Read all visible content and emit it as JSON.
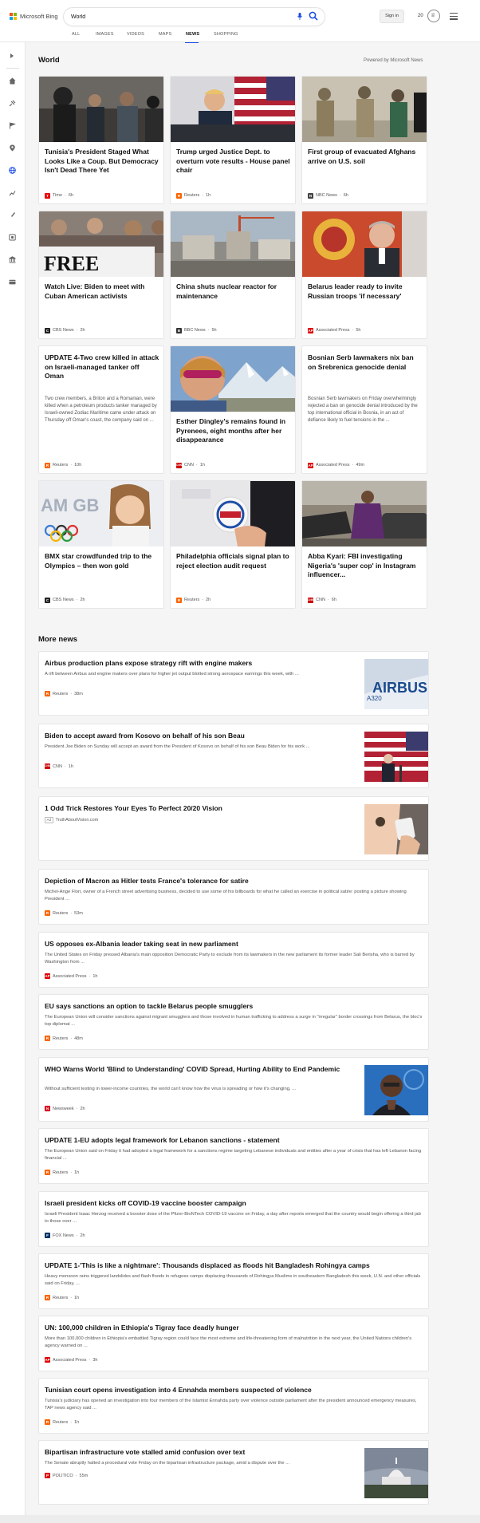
{
  "header": {
    "brand": "Microsoft Bing",
    "query": "World",
    "signin_label": "Sign in",
    "points": "20",
    "brand_colors": [
      "#f25022",
      "#7fba00",
      "#00a4ef",
      "#ffb900"
    ],
    "accent": "#174ae4"
  },
  "tabs": [
    "ALL",
    "IMAGES",
    "VIDEOS",
    "MAPS",
    "NEWS",
    "SHOPPING"
  ],
  "active_tab": "NEWS",
  "sidebar_icons": [
    "expand-icon",
    "home-icon",
    "sports-icon",
    "flag-icon",
    "location-pin-icon",
    "globe-icon",
    "business-icon",
    "science-icon",
    "entertainment-icon",
    "politics-icon",
    "money-icon"
  ],
  "main": {
    "title": "World",
    "powered": "Powered by Microsoft News",
    "more_news_title": "More news"
  },
  "cards": [
    {
      "title": "Tunisia's President Staged What Looks Like a Coup. But Democracy Isn't Dead There Yet",
      "source": "Time",
      "age": "6h",
      "logo": "T",
      "logo_color": "#e90606"
    },
    {
      "title": "Trump urged Justice Dept. to overturn vote results - House panel chair",
      "source": "Reuters",
      "age": "1h",
      "logo": "R",
      "logo_color": "#fa6400"
    },
    {
      "title": "First group of evacuated Afghans arrive on U.S. soil",
      "source": "NBC News",
      "age": "6h",
      "logo": "N",
      "logo_color": "#444444"
    },
    {
      "title": "Watch Live: Biden to meet with Cuban American activists",
      "source": "CBS News",
      "age": "2h",
      "logo": "C",
      "logo_color": "#222222"
    },
    {
      "title": "China shuts nuclear reactor for maintenance",
      "source": "BBC News",
      "age": "5h",
      "logo": "B",
      "logo_color": "#333333"
    },
    {
      "title": "Belarus leader ready to invite Russian troops 'if necessary'",
      "source": "Associated Press",
      "age": "5h",
      "logo": "AP",
      "logo_color": "#e00000"
    },
    {
      "title": "UPDATE 4-Two crew killed in attack on Israeli-managed tanker off Oman",
      "snippet": "Two crew members, a Briton and a Romanian, were killed when a petroleum products tanker managed by Israeli-owned Zodiac Maritime came under attack on Thursday off Oman's coast, the company said on ...",
      "source": "Reuters",
      "age": "10h",
      "logo": "R",
      "logo_color": "#fa6400"
    },
    {
      "title": "Esther Dingley's remains found in Pyrenees, eight months after her disappearance",
      "source": "CNN",
      "age": "1h",
      "logo": "CNN",
      "logo_color": "#cc0000"
    },
    {
      "title": "Bosnian Serb lawmakers nix ban on Srebrenica genocide denial",
      "snippet": "Bosnian Serb lawmakers on Friday overwhelmingly rejected a ban on genocide denial introduced by the top international official in Bosnia, in an act of defiance likely to fuel tensions in the ...",
      "source": "Associated Press",
      "age": "49m",
      "logo": "AP",
      "logo_color": "#e00000"
    },
    {
      "title": "BMX star crowdfunded trip to the Olympics – then won gold",
      "source": "CBS News",
      "age": "2h",
      "logo": "C",
      "logo_color": "#222222"
    },
    {
      "title": "Philadelphia officials signal plan to reject election audit request",
      "source": "Reuters",
      "age": "2h",
      "logo": "R",
      "logo_color": "#fa6400"
    },
    {
      "title": "Abba Kyari: FBI investigating Nigeria's 'super cop' in Instagram influencer...",
      "source": "CNN",
      "age": "6h",
      "logo": "CNN",
      "logo_color": "#cc0000"
    }
  ],
  "more_news": [
    {
      "title": "Airbus production plans expose strategy rift with engine makers",
      "snippet": "A rift between Airbus and engine makers over plans for higher jet output blotted strong aerospace earnings this week, with ...",
      "source": "Reuters",
      "age": "38m",
      "logo": "R",
      "logo_color": "#fa6400",
      "image": "airbus"
    },
    {
      "title": "Biden to accept award from Kosovo on behalf of his son Beau",
      "snippet": "President Joe Biden on Sunday will accept an award from the President of Kosovo on behalf of his son Beau Biden for his work ...",
      "source": "CNN",
      "age": "1h",
      "logo": "CNN",
      "logo_color": "#cc0000",
      "image": "biden"
    },
    {
      "title": "1 Odd Trick Restores Your Eyes To Perfect 20/20 Vision",
      "ad": "Ad",
      "source": "TruthAboutVision.com",
      "image": "vision"
    },
    {
      "title": "Depiction of Macron as Hitler tests France's tolerance for satire",
      "snippet": "Michel-Ange Flori, owner of a French street advertising business, decided to use some of his billboards for what he called an exercise in political satire: posting a picture showing President ...",
      "source": "Reuters",
      "age": "53m",
      "logo": "R",
      "logo_color": "#fa6400"
    },
    {
      "title": "US opposes ex-Albania leader taking seat in new parliament",
      "snippet": "The United States on Friday pressed Albania's main opposition Democratic Party to exclude from its lawmakers in the new parliament its former leader Sali Berisha, who is barred by Washington from ...",
      "source": "Associated Press",
      "age": "1h",
      "logo": "AP",
      "logo_color": "#e00000"
    },
    {
      "title": "EU says sanctions an option to tackle Belarus people smugglers",
      "snippet": "The European Union will consider sanctions against migrant smugglers and those involved in human trafficking to address a surge in \"irregular\" border crossings from Belarus, the bloc's top diplomat ...",
      "source": "Reuters",
      "age": "48m",
      "logo": "R",
      "logo_color": "#fa6400"
    },
    {
      "title": "WHO Warns World 'Blind to Understanding' COVID Spread, Hurting Ability to End Pandemic",
      "snippet": "Without sufficient testing in lower-income countries, the world can't know how the virus is spreading or how it's changing, ...",
      "source": "Newsweek",
      "age": "2h",
      "logo": "N",
      "logo_color": "#d6001c",
      "image": "who"
    },
    {
      "title": "UPDATE 1-EU adopts legal framework for Lebanon sanctions - statement",
      "snippet": "The European Union said on Friday it had adopted a legal framework for a sanctions regime targeting Lebanese individuals and entities after a year of crisis that has left Lebanon facing financial ...",
      "source": "Reuters",
      "age": "1h",
      "logo": "R",
      "logo_color": "#fa6400"
    },
    {
      "title": "Israeli president kicks off COVID-19 vaccine booster campaign",
      "snippet": "Israeli President Isaac Herzog received a booster dose of the Pfizer-BioNTech COVID-19 vaccine on Friday, a day after reports emerged that the country would begin offering a third jab to those over ...",
      "source": "FOX News",
      "age": "2h",
      "logo": "F",
      "logo_color": "#003366"
    },
    {
      "title": "UPDATE 1-'This is like a nightmare': Thousands displaced as floods hit Bangladesh Rohingya camps",
      "snippet": "Heavy monsoon rains triggered landslides and flash floods in refugees camps displacing thousands of Rohingya Muslims in southeastern Bangladesh this week, U.N. and other officials said on Friday, ...",
      "source": "Reuters",
      "age": "1h",
      "logo": "R",
      "logo_color": "#fa6400"
    },
    {
      "title": "UN: 100,000 children in Ethiopia's Tigray face deadly hunger",
      "snippet": "More than 100,000 children in Ethiopia's embattled Tigray region could face the most extreme and life-threatening form of malnutrition in the next year, the United Nations children's agency warned on ...",
      "source": "Associated Press",
      "age": "3h",
      "logo": "AP",
      "logo_color": "#e00000"
    },
    {
      "title": "Tunisian court opens investigation into 4 Ennahda members suspected of violence",
      "snippet": "Tunisia's judiciary has opened an investigation into four members of the Islamist Ennahda party over violence outside parliament after the president announced emergency measures, TAP news agency said ...",
      "source": "Reuters",
      "age": "1h",
      "logo": "R",
      "logo_color": "#fa6400"
    },
    {
      "title": "Bipartisan infrastructure vote stalled amid confusion over text",
      "snippet": "The Senate abruptly halted a procedural vote Friday on the bipartisan infrastructure package, amid a dispute over the ...",
      "source": "POLITICO",
      "age": "55m",
      "logo": "P",
      "logo_color": "#dc0a0a",
      "image": "capitol"
    }
  ]
}
